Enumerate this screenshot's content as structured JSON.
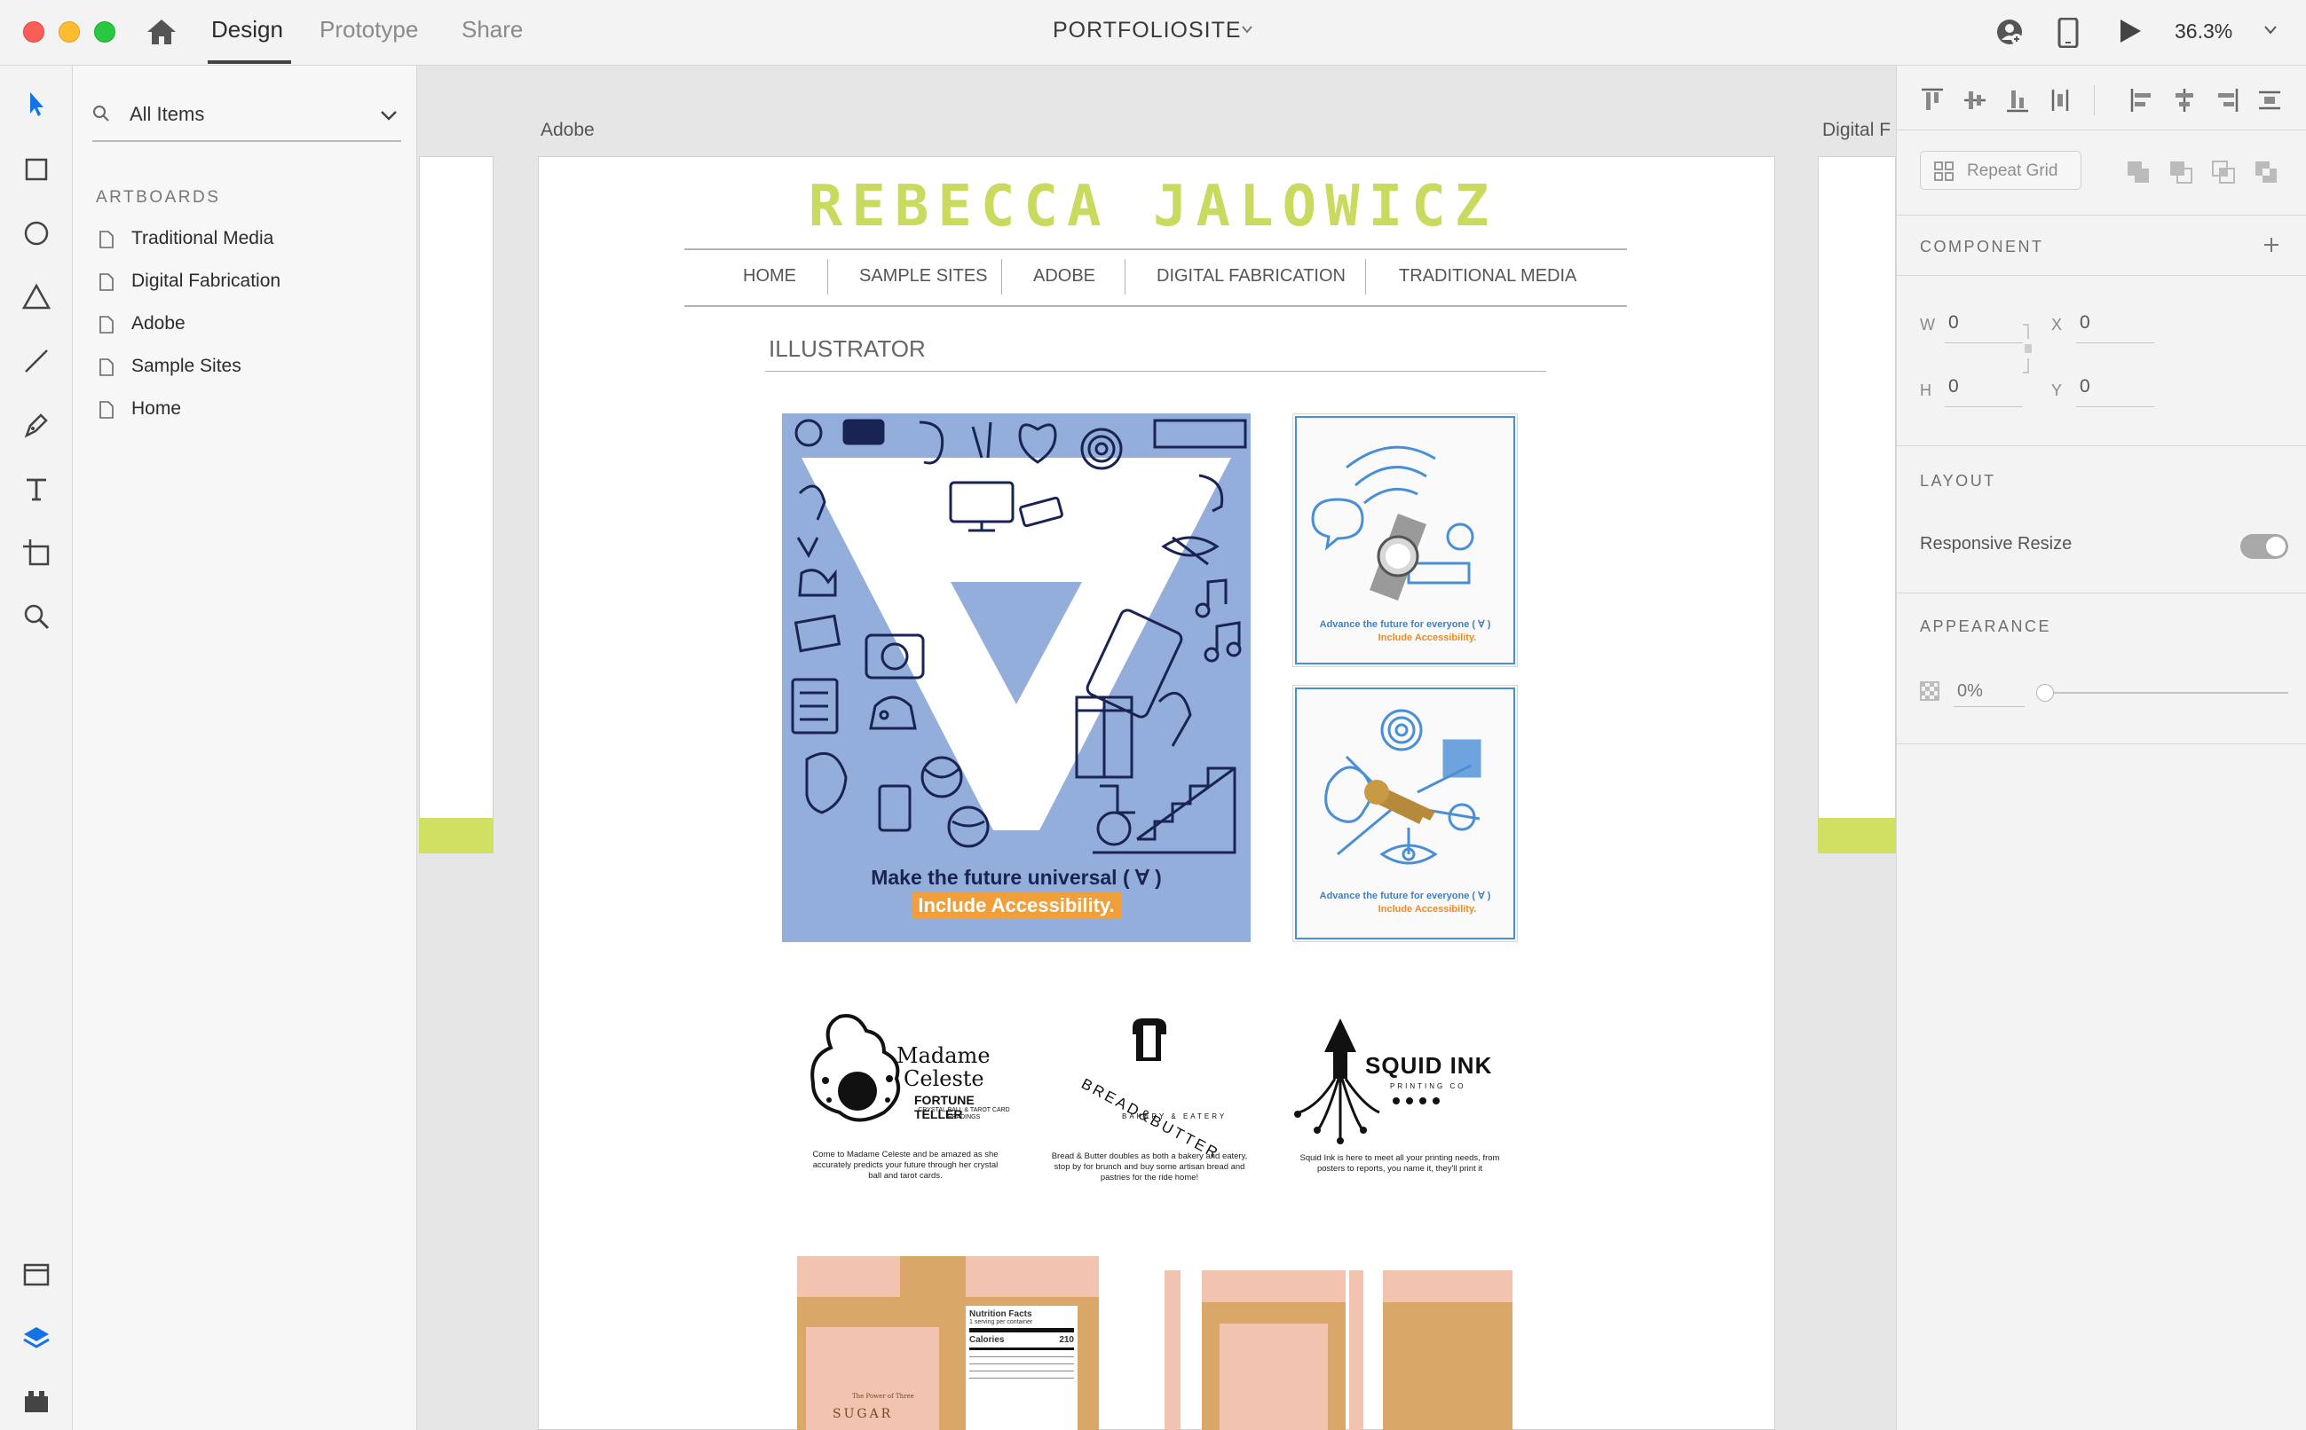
{
  "app": {
    "modes": [
      "Design",
      "Prototype",
      "Share"
    ],
    "active_mode": "Design",
    "document_title": "PORTFOLIOSITE",
    "zoom": "36.3%"
  },
  "layers_panel": {
    "search_label": "All Items",
    "section_title": "ARTBOARDS",
    "artboards": [
      "Traditional Media",
      "Digital Fabrication",
      "Adobe",
      "Sample Sites",
      "Home"
    ]
  },
  "canvas": {
    "artboard_labels": [
      "Adobe",
      "Digital F"
    ]
  },
  "page": {
    "site_name": "REBECCA JALOWICZ",
    "nav": [
      "HOME",
      "SAMPLE SITES",
      "ADOBE",
      "DIGITAL FABRICATION",
      "TRADITIONAL MEDIA"
    ],
    "section_title": "ILLUSTRATOR",
    "poster": {
      "caption_line1": "Make the future universal ( ∀ )",
      "caption_line2": "Include Accessibility."
    },
    "small_posters": [
      {
        "line1": "Advance the future for everyone ( ∀ )",
        "line2": "Include Accessibility."
      },
      {
        "line1": "Advance the future for everyone ( ∀ )",
        "line2": "Include Accessibility."
      }
    ],
    "logos": [
      {
        "title_line1": "Madame",
        "title_line2": "Celeste",
        "subtitle": "FORTUNE TELLER",
        "tagline": "CRYSTAL BALL & TAROT CARD READINGS",
        "caption": "Come to Madame Celeste and be amazed as she accurately predicts your future through her crystal ball and tarot cards."
      },
      {
        "title": "BREAD&BUTTER",
        "subtitle": "BAKERY & EATERY",
        "caption": "Bread & Butter doubles as both a bakery and eatery, stop by for brunch and buy some artisan bread and pastries for the ride home!"
      },
      {
        "title": "SQUID INK",
        "subtitle": "PRINTING CO",
        "caption": "Squid Ink is here to meet all your printing needs, from posters to reports, you name it, they'll print it"
      }
    ],
    "packaging": {
      "nutrition_title": "Nutrition Facts",
      "nutrition_serving": "1 serving per container",
      "calories_label": "Calories",
      "calories_value": "210",
      "box_brand": "SUGAR",
      "box_sub": "The Power of Three"
    }
  },
  "properties_panel": {
    "repeat_grid": "Repeat Grid",
    "component_heading": "COMPONENT",
    "w_label": "W",
    "w_value": "0",
    "h_label": "H",
    "h_value": "0",
    "x_label": "X",
    "x_value": "0",
    "y_label": "Y",
    "y_value": "0",
    "layout_heading": "LAYOUT",
    "responsive_resize": "Responsive Resize",
    "responsive_resize_on": true,
    "appearance_heading": "APPEARANCE",
    "opacity": "0%"
  },
  "colors": {
    "site_green": "#c9da5f",
    "poster_blue": "#94aedb",
    "poster_navy": "#1a2454",
    "accent_orange": "#f19f3a",
    "selected_tool_blue": "#1473e6"
  }
}
